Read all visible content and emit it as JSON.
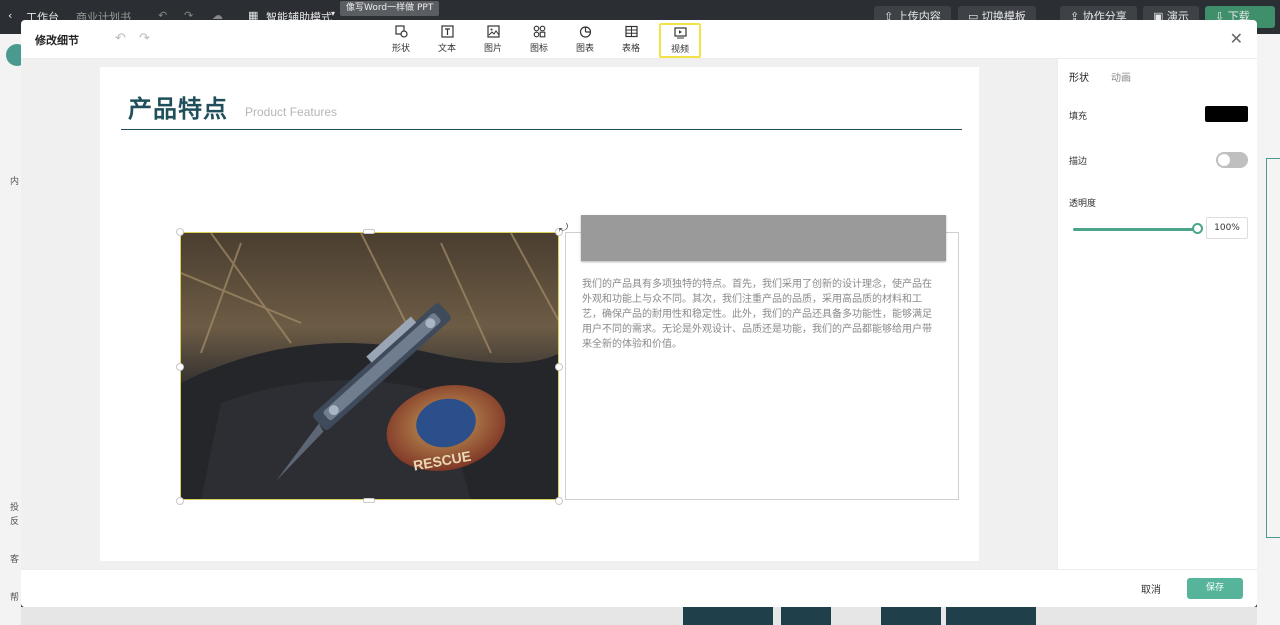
{
  "bg": {
    "back_label": "工作台",
    "doc_name": "商业计划书",
    "mode_label": "智能辅助模式",
    "tooltip": "像写Word一样做 PPT",
    "upload": "上传内容",
    "switch_template": "切换模板",
    "share": "协作分享",
    "present": "演示",
    "download": "下载",
    "left_txt1": "内",
    "left_txt2": "投",
    "left_txt3": "反",
    "left_txt4": "客",
    "left_txt5": "帮"
  },
  "modal": {
    "title": "修改细节",
    "undo": "↶",
    "redo": "↷",
    "close": "✕",
    "tools": [
      {
        "label": "形状"
      },
      {
        "label": "文本"
      },
      {
        "label": "图片"
      },
      {
        "label": "图标"
      },
      {
        "label": "图表"
      },
      {
        "label": "表格"
      },
      {
        "label": "视频"
      }
    ]
  },
  "slide": {
    "title": "产品特点",
    "subtitle": "Product Features",
    "body": "我们的产品具有多项独特的特点。首先，我们采用了创新的设计理念，使产品在外观和功能上与众不同。其次，我们注重产品的品质，采用高品质的材料和工艺，确保产品的耐用性和稳定性。此外，我们的产品还具备多功能性，能够满足用户不同的需求。无论是外观设计、品质还是功能，我们的产品都能够给用户带来全新的体验和价值。",
    "patch_text": "RESCUE"
  },
  "panel": {
    "tab_shape": "形状",
    "tab_animation": "动画",
    "fill_label": "填充",
    "fill_color": "#000000",
    "stroke_label": "描边",
    "opacity_label": "透明度",
    "opacity_value": "100%",
    "opacity": 1.0
  },
  "footer": {
    "cancel": "取消",
    "save": "保存"
  },
  "colors": {
    "accent": "#55b49a",
    "title": "#1f4f5a",
    "highlight": "#f2e34b",
    "arrow": "#4aa3e8"
  }
}
